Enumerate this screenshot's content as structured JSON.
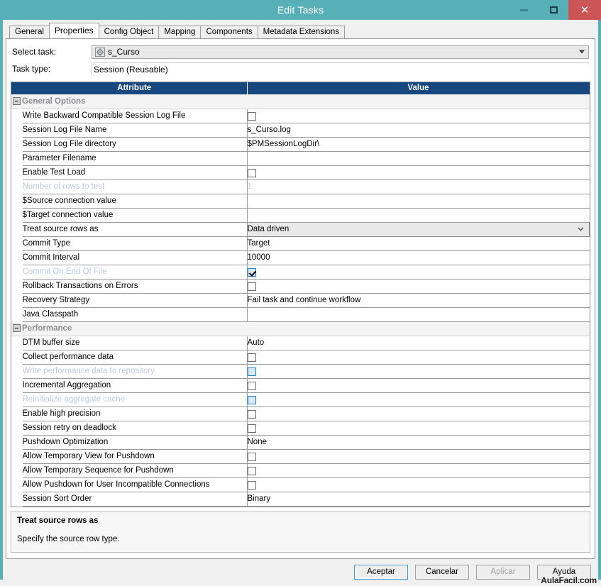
{
  "window": {
    "title": "Edit Tasks",
    "controls": {
      "minimize": "minimize-icon",
      "maximize": "maximize-icon",
      "close": "close-icon"
    },
    "titlebar_color": "#57afb8",
    "close_color": "#cc5555"
  },
  "tabs": [
    {
      "label": "General",
      "active": false
    },
    {
      "label": "Properties",
      "active": true
    },
    {
      "label": "Config Object",
      "active": false
    },
    {
      "label": "Mapping",
      "active": false
    },
    {
      "label": "Components",
      "active": false
    },
    {
      "label": "Metadata Extensions",
      "active": false
    }
  ],
  "form": {
    "select_task_label": "Select task:",
    "select_task_value": "s_Curso",
    "task_type_label": "Task type:",
    "task_type_value": "Session (Reusable)"
  },
  "grid": {
    "headers": {
      "attribute": "Attribute",
      "value": "Value"
    },
    "rows": [
      {
        "kind": "group",
        "attribute": "General Options"
      },
      {
        "kind": "check",
        "attribute": "Write Backward Compatible Session Log File",
        "checked": false,
        "state": "enabled"
      },
      {
        "kind": "text",
        "attribute": "Session Log File Name",
        "value": "s_Curso.log",
        "state": "enabled"
      },
      {
        "kind": "text",
        "attribute": "Session Log File directory",
        "value": "$PMSessionLogDir\\",
        "state": "enabled"
      },
      {
        "kind": "text",
        "attribute": "Parameter Filename",
        "value": "",
        "state": "enabled"
      },
      {
        "kind": "check",
        "attribute": "Enable Test Load",
        "checked": false,
        "state": "enabled"
      },
      {
        "kind": "text",
        "attribute": "Number of rows to test",
        "value": "1",
        "state": "disabled"
      },
      {
        "kind": "text",
        "attribute": "$Source connection value",
        "value": "",
        "state": "enabled"
      },
      {
        "kind": "text",
        "attribute": "$Target connection value",
        "value": "",
        "state": "enabled"
      },
      {
        "kind": "combo",
        "attribute": "Treat source rows as",
        "value": "Data driven",
        "state": "selected"
      },
      {
        "kind": "text",
        "attribute": "Commit Type",
        "value": "Target",
        "state": "enabled"
      },
      {
        "kind": "text",
        "attribute": "Commit Interval",
        "value": "10000",
        "state": "enabled"
      },
      {
        "kind": "check",
        "attribute": "Commit On End Of File",
        "checked": true,
        "state": "disabled"
      },
      {
        "kind": "check",
        "attribute": "Rollback Transactions on Errors",
        "checked": false,
        "state": "enabled"
      },
      {
        "kind": "text",
        "attribute": "Recovery Strategy",
        "value": "Fail task and continue workflow",
        "state": "enabled"
      },
      {
        "kind": "text",
        "attribute": "Java Classpath",
        "value": "",
        "state": "enabled"
      },
      {
        "kind": "group",
        "attribute": "Performance"
      },
      {
        "kind": "text",
        "attribute": "DTM buffer size",
        "value": "Auto",
        "state": "enabled"
      },
      {
        "kind": "check",
        "attribute": "Collect performance data",
        "checked": false,
        "state": "enabled"
      },
      {
        "kind": "check",
        "attribute": "Write performance data to repository",
        "checked": false,
        "state": "disabled"
      },
      {
        "kind": "check",
        "attribute": "Incremental Aggregation",
        "checked": false,
        "state": "enabled"
      },
      {
        "kind": "check",
        "attribute": "Reinitialize aggregate cache",
        "checked": false,
        "state": "disabled"
      },
      {
        "kind": "check",
        "attribute": "Enable high precision",
        "checked": false,
        "state": "enabled"
      },
      {
        "kind": "check",
        "attribute": "Session retry on deadlock",
        "checked": false,
        "state": "enabled"
      },
      {
        "kind": "text",
        "attribute": "Pushdown Optimization",
        "value": "None",
        "state": "enabled"
      },
      {
        "kind": "check",
        "attribute": "Allow Temporary View for Pushdown",
        "checked": false,
        "state": "enabled"
      },
      {
        "kind": "check",
        "attribute": "Allow Temporary Sequence for Pushdown",
        "checked": false,
        "state": "enabled"
      },
      {
        "kind": "check",
        "attribute": "Allow Pushdown for User Incompatible Connections",
        "checked": false,
        "state": "enabled"
      },
      {
        "kind": "text",
        "attribute": "Session Sort Order",
        "value": "Binary",
        "state": "enabled"
      }
    ]
  },
  "description": {
    "title": "Treat source rows as",
    "body": "Specify the source row type."
  },
  "buttons": [
    {
      "label": "Aceptar",
      "state": "default"
    },
    {
      "label": "Cancelar",
      "state": "enabled"
    },
    {
      "label": "Aplicar",
      "state": "disabled"
    },
    {
      "label": "Ayuda",
      "state": "enabled"
    }
  ],
  "watermark": "AulaFacil.com"
}
